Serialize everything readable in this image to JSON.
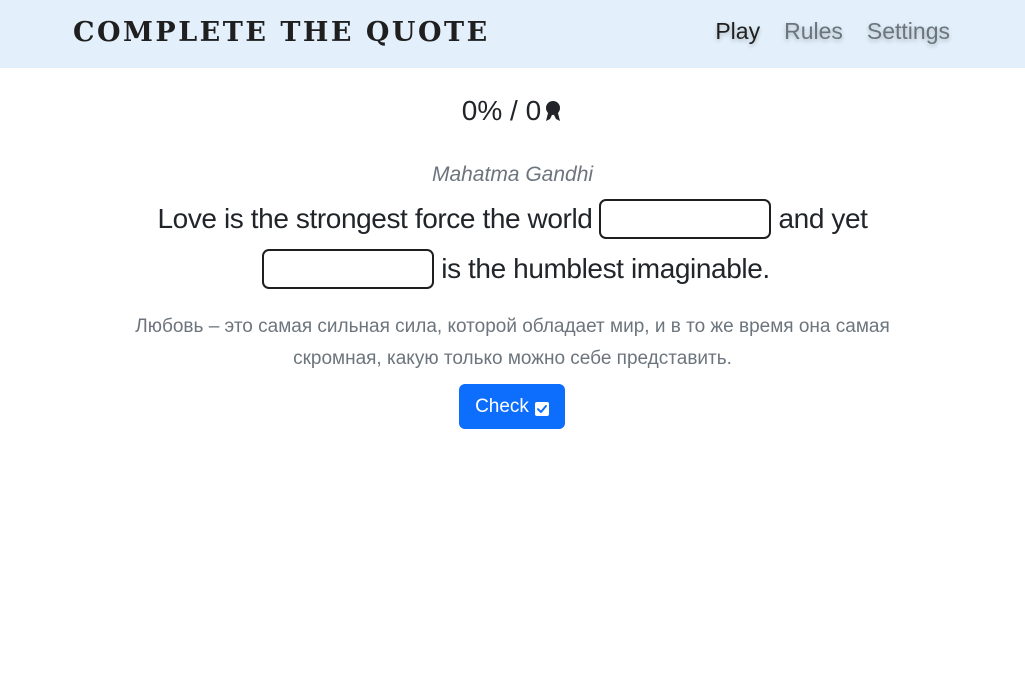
{
  "header": {
    "brand": "COMPLETE THE QUOTE",
    "nav": [
      {
        "label": "Play",
        "active": true
      },
      {
        "label": "Rules",
        "active": false
      },
      {
        "label": "Settings",
        "active": false
      }
    ]
  },
  "score": {
    "text": "0% / 0",
    "icon": "award-icon"
  },
  "quote": {
    "author": "Mahatma Gandhi",
    "line1_before": "Love is the strongest force the world",
    "line1_after": "and yet",
    "line2_after": "is the humblest imaginable.",
    "blank1_value": "",
    "blank2_value": ""
  },
  "translation": {
    "line1": "Любовь – это самая сильная сила, которой обладает мир, и в то же время она самая",
    "line2": "скромная, какую только можно себе представить."
  },
  "actions": {
    "check_label": "Check",
    "check_icon": "check-square-icon"
  },
  "colors": {
    "navbar_bg": "#e3f0fb",
    "primary": "#0d6efd",
    "muted": "#6c757d",
    "text": "#212529"
  }
}
